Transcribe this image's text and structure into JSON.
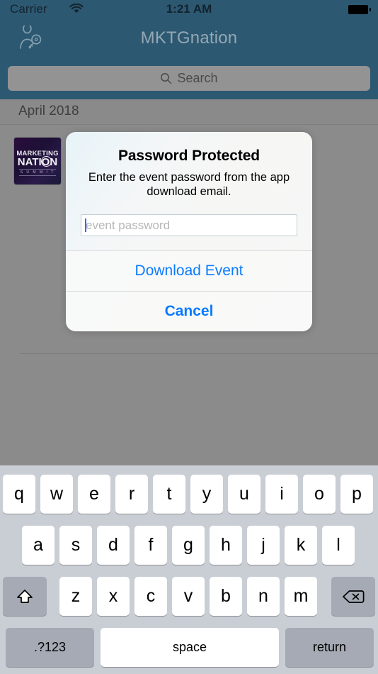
{
  "status_bar": {
    "carrier": "Carrier",
    "wifi_icon": "wifi-icon",
    "time": "1:21 AM",
    "battery_icon": "battery-full-icon"
  },
  "nav_bar": {
    "title": "MKTGnation",
    "left_icon": "person-key-icon"
  },
  "search": {
    "placeholder": "Search",
    "icon": "search-icon",
    "value": ""
  },
  "list": {
    "section_header": "April 2018",
    "rows": [
      {
        "thumbnail": {
          "line1": "MARKETING",
          "line2": "NATION",
          "line3": "S U M M I T",
          "alt": "marketing-nation-summit-logo"
        }
      }
    ]
  },
  "dialog": {
    "title": "Password Protected",
    "message": "Enter the event password from the app download email.",
    "input": {
      "placeholder": "event password",
      "value": ""
    },
    "actions": [
      {
        "label": "Download Event",
        "style": "normal"
      },
      {
        "label": "Cancel",
        "style": "bold"
      }
    ]
  },
  "keyboard": {
    "rows": [
      [
        "q",
        "w",
        "e",
        "r",
        "t",
        "y",
        "u",
        "i",
        "o",
        "p"
      ],
      [
        "a",
        "s",
        "d",
        "f",
        "g",
        "h",
        "j",
        "k",
        "l"
      ],
      [
        "z",
        "x",
        "c",
        "v",
        "b",
        "n",
        "m"
      ]
    ],
    "shift_icon": "shift-arrow-icon",
    "delete_icon": "backspace-delete-icon",
    "numbers_key": ".?123",
    "space_key": "space",
    "return_key": "return"
  },
  "colors": {
    "nav_bar": "#2d5871",
    "accent_blue": "#0a7bff",
    "caret_blue": "#2b6ef5",
    "content_gray": "#8b8b8b",
    "keyboard_bg": "#c9cdd4",
    "key_dark": "#a5aab4"
  }
}
